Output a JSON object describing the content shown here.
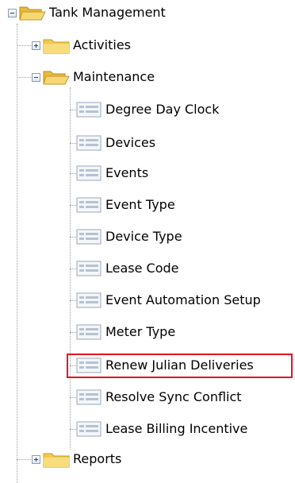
{
  "tree": {
    "root": {
      "label": "Tank Management",
      "icon": "folder-open-icon",
      "expanded": true
    },
    "activities": {
      "label": "Activities",
      "icon": "folder-icon",
      "expanded": false
    },
    "maintenance": {
      "label": "Maintenance",
      "icon": "folder-open-icon",
      "expanded": true,
      "items": [
        {
          "label": "Degree Day Clock",
          "icon": "form-page-icon"
        },
        {
          "label": "Devices",
          "icon": "form-page-icon"
        },
        {
          "label": "Events",
          "icon": "form-page-icon"
        },
        {
          "label": "Event Type",
          "icon": "form-page-icon"
        },
        {
          "label": "Device Type",
          "icon": "form-page-icon"
        },
        {
          "label": "Lease Code",
          "icon": "form-page-icon"
        },
        {
          "label": "Event Automation Setup",
          "icon": "form-page-icon"
        },
        {
          "label": "Meter Type",
          "icon": "form-page-icon"
        },
        {
          "label": "Renew Julian Deliveries",
          "icon": "form-page-icon"
        },
        {
          "label": "Resolve Sync Conflict",
          "icon": "form-page-icon"
        },
        {
          "label": "Lease Billing Incentive",
          "icon": "form-page-icon"
        }
      ]
    },
    "reports": {
      "label": "Reports",
      "icon": "folder-icon",
      "expanded": false
    }
  },
  "colors": {
    "highlight": "#e8121c",
    "folder": "#f2c94c",
    "tree_lines": "#a0a0a0"
  }
}
